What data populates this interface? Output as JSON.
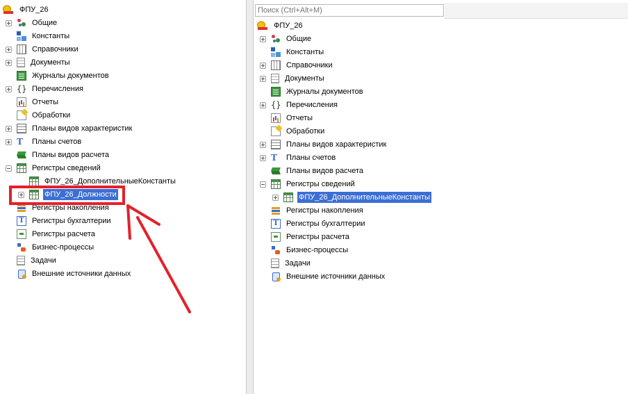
{
  "left_tree": {
    "root": "ФПУ_26",
    "items": [
      {
        "label": "Общие",
        "icon": "common-icon",
        "expander": "plus"
      },
      {
        "label": "Константы",
        "icon": "constants-icon",
        "expander": "none"
      },
      {
        "label": "Справочники",
        "icon": "catalogs-icon",
        "expander": "plus"
      },
      {
        "label": "Документы",
        "icon": "documents-icon",
        "expander": "plus"
      },
      {
        "label": "Журналы документов",
        "icon": "document-journals-icon",
        "expander": "none"
      },
      {
        "label": "Перечисления",
        "icon": "enumerations-icon",
        "expander": "plus"
      },
      {
        "label": "Отчеты",
        "icon": "reports-icon",
        "expander": "none"
      },
      {
        "label": "Обработки",
        "icon": "data-processors-icon",
        "expander": "none"
      },
      {
        "label": "Планы видов характеристик",
        "icon": "characteristic-types-icon",
        "expander": "plus"
      },
      {
        "label": "Планы счетов",
        "icon": "charts-of-accounts-icon",
        "expander": "plus"
      },
      {
        "label": "Планы видов расчета",
        "icon": "calculation-types-icon",
        "expander": "none"
      },
      {
        "label": "Регистры сведений",
        "icon": "information-registers-icon",
        "expander": "minus"
      },
      {
        "label": "ФПУ_26_ДополнительныеКонстанты",
        "icon": "register-icon",
        "expander": "none",
        "child": true
      },
      {
        "label": "ФПУ_26_Должности",
        "icon": "register-icon",
        "expander": "plus",
        "child": true,
        "selected": true
      },
      {
        "label": "Регистры накопления",
        "icon": "accumulation-registers-icon",
        "expander": "none"
      },
      {
        "label": "Регистры бухгалтерии",
        "icon": "accounting-registers-icon",
        "expander": "none"
      },
      {
        "label": "Регистры расчета",
        "icon": "calculation-registers-icon",
        "expander": "none"
      },
      {
        "label": "Бизнес-процессы",
        "icon": "business-processes-icon",
        "expander": "none"
      },
      {
        "label": "Задачи",
        "icon": "tasks-icon",
        "expander": "none"
      },
      {
        "label": "Внешние источники данных",
        "icon": "external-data-sources-icon",
        "expander": "none"
      }
    ]
  },
  "right_tree": {
    "search_placeholder": "Поиск (Ctrl+Alt+M)",
    "root": "ФПУ_26",
    "items": [
      {
        "label": "Общие",
        "icon": "common-icon",
        "expander": "plus"
      },
      {
        "label": "Константы",
        "icon": "constants-icon",
        "expander": "none"
      },
      {
        "label": "Справочники",
        "icon": "catalogs-icon",
        "expander": "plus"
      },
      {
        "label": "Документы",
        "icon": "documents-icon",
        "expander": "plus"
      },
      {
        "label": "Журналы документов",
        "icon": "document-journals-icon",
        "expander": "none"
      },
      {
        "label": "Перечисления",
        "icon": "enumerations-icon",
        "expander": "plus"
      },
      {
        "label": "Отчеты",
        "icon": "reports-icon",
        "expander": "none"
      },
      {
        "label": "Обработки",
        "icon": "data-processors-icon",
        "expander": "none"
      },
      {
        "label": "Планы видов характеристик",
        "icon": "characteristic-types-icon",
        "expander": "plus"
      },
      {
        "label": "Планы счетов",
        "icon": "charts-of-accounts-icon",
        "expander": "plus"
      },
      {
        "label": "Планы видов расчета",
        "icon": "calculation-types-icon",
        "expander": "none"
      },
      {
        "label": "Регистры сведений",
        "icon": "information-registers-icon",
        "expander": "minus"
      },
      {
        "label": "ФПУ_26_ДополнительныеКонстанты",
        "icon": "register-icon",
        "expander": "plus",
        "child": true,
        "selected": true
      },
      {
        "label": "Регистры накопления",
        "icon": "accumulation-registers-icon",
        "expander": "none"
      },
      {
        "label": "Регистры бухгалтерии",
        "icon": "accounting-registers-icon",
        "expander": "none"
      },
      {
        "label": "Регистры расчета",
        "icon": "calculation-registers-icon",
        "expander": "none"
      },
      {
        "label": "Бизнес-процессы",
        "icon": "business-processes-icon",
        "expander": "none"
      },
      {
        "label": "Задачи",
        "icon": "tasks-icon",
        "expander": "none"
      },
      {
        "label": "Внешние источники данных",
        "icon": "external-data-sources-icon",
        "expander": "none"
      }
    ]
  },
  "annotation": {
    "highlight_color": "#e4202a",
    "arrow_color": "#e4202a"
  },
  "colors": {
    "selection": "#3c6fd4"
  }
}
